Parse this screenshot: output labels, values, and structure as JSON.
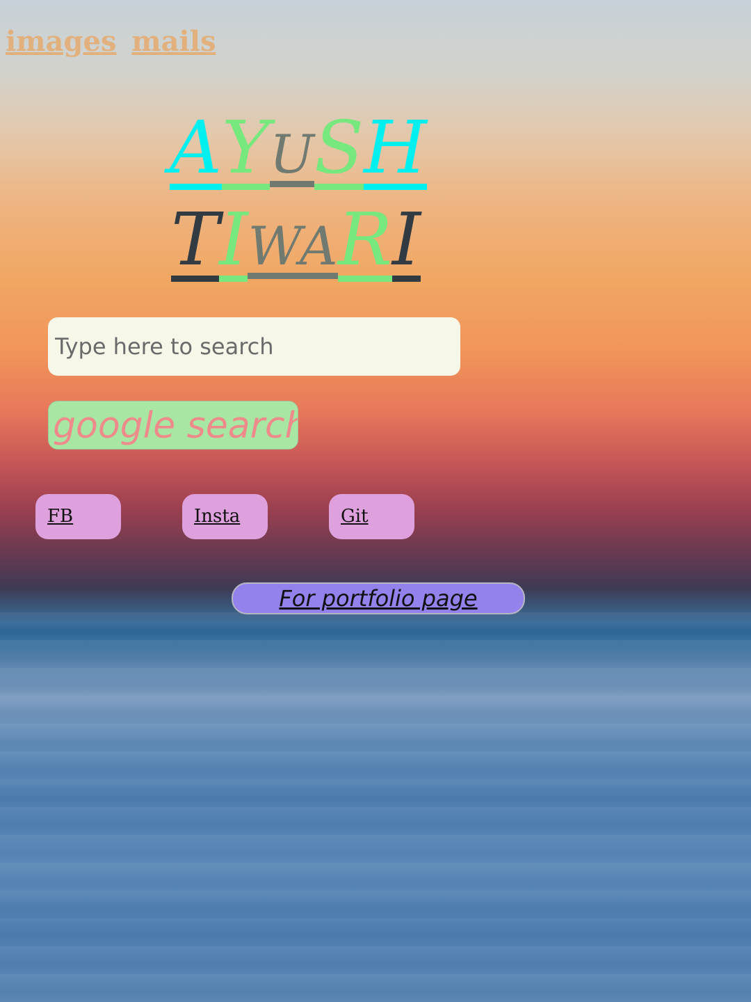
{
  "nav": {
    "items": [
      {
        "label": "images"
      },
      {
        "label": "mails"
      }
    ],
    "color": "#e2b07c"
  },
  "name": {
    "line1": [
      {
        "text": "A",
        "color": "#00f0f0",
        "size": "big"
      },
      {
        "text": "Y",
        "color": "#77e87e",
        "size": "big"
      },
      {
        "text": "U",
        "color": "#717a70",
        "size": "small"
      },
      {
        "text": "S",
        "color": "#77e87e",
        "size": "big"
      },
      {
        "text": "H",
        "color": "#00f0f0",
        "size": "big"
      }
    ],
    "line2": [
      {
        "text": "T",
        "color": "#313b41",
        "size": "big"
      },
      {
        "text": "I",
        "color": "#77e87e",
        "size": "big"
      },
      {
        "text": "WA",
        "color": "#717a70",
        "size": "small"
      },
      {
        "text": "R",
        "color": "#77e87e",
        "size": "big"
      },
      {
        "text": "I",
        "color": "#313b41",
        "size": "big"
      }
    ]
  },
  "search": {
    "placeholder": "Type here to search",
    "value": ""
  },
  "google_button": {
    "label": "google search"
  },
  "social": [
    {
      "label": "FB"
    },
    {
      "label": "Insta"
    },
    {
      "label": "Git"
    }
  ],
  "portfolio": {
    "label": "For portfolio page"
  },
  "colors": {
    "search_bg": "#f6f7e8",
    "google_bg": "#a8e6a4",
    "google_text": "#ef8a8a",
    "social_bg": "#dea1dd",
    "portfolio_bg": "#9382ec"
  }
}
